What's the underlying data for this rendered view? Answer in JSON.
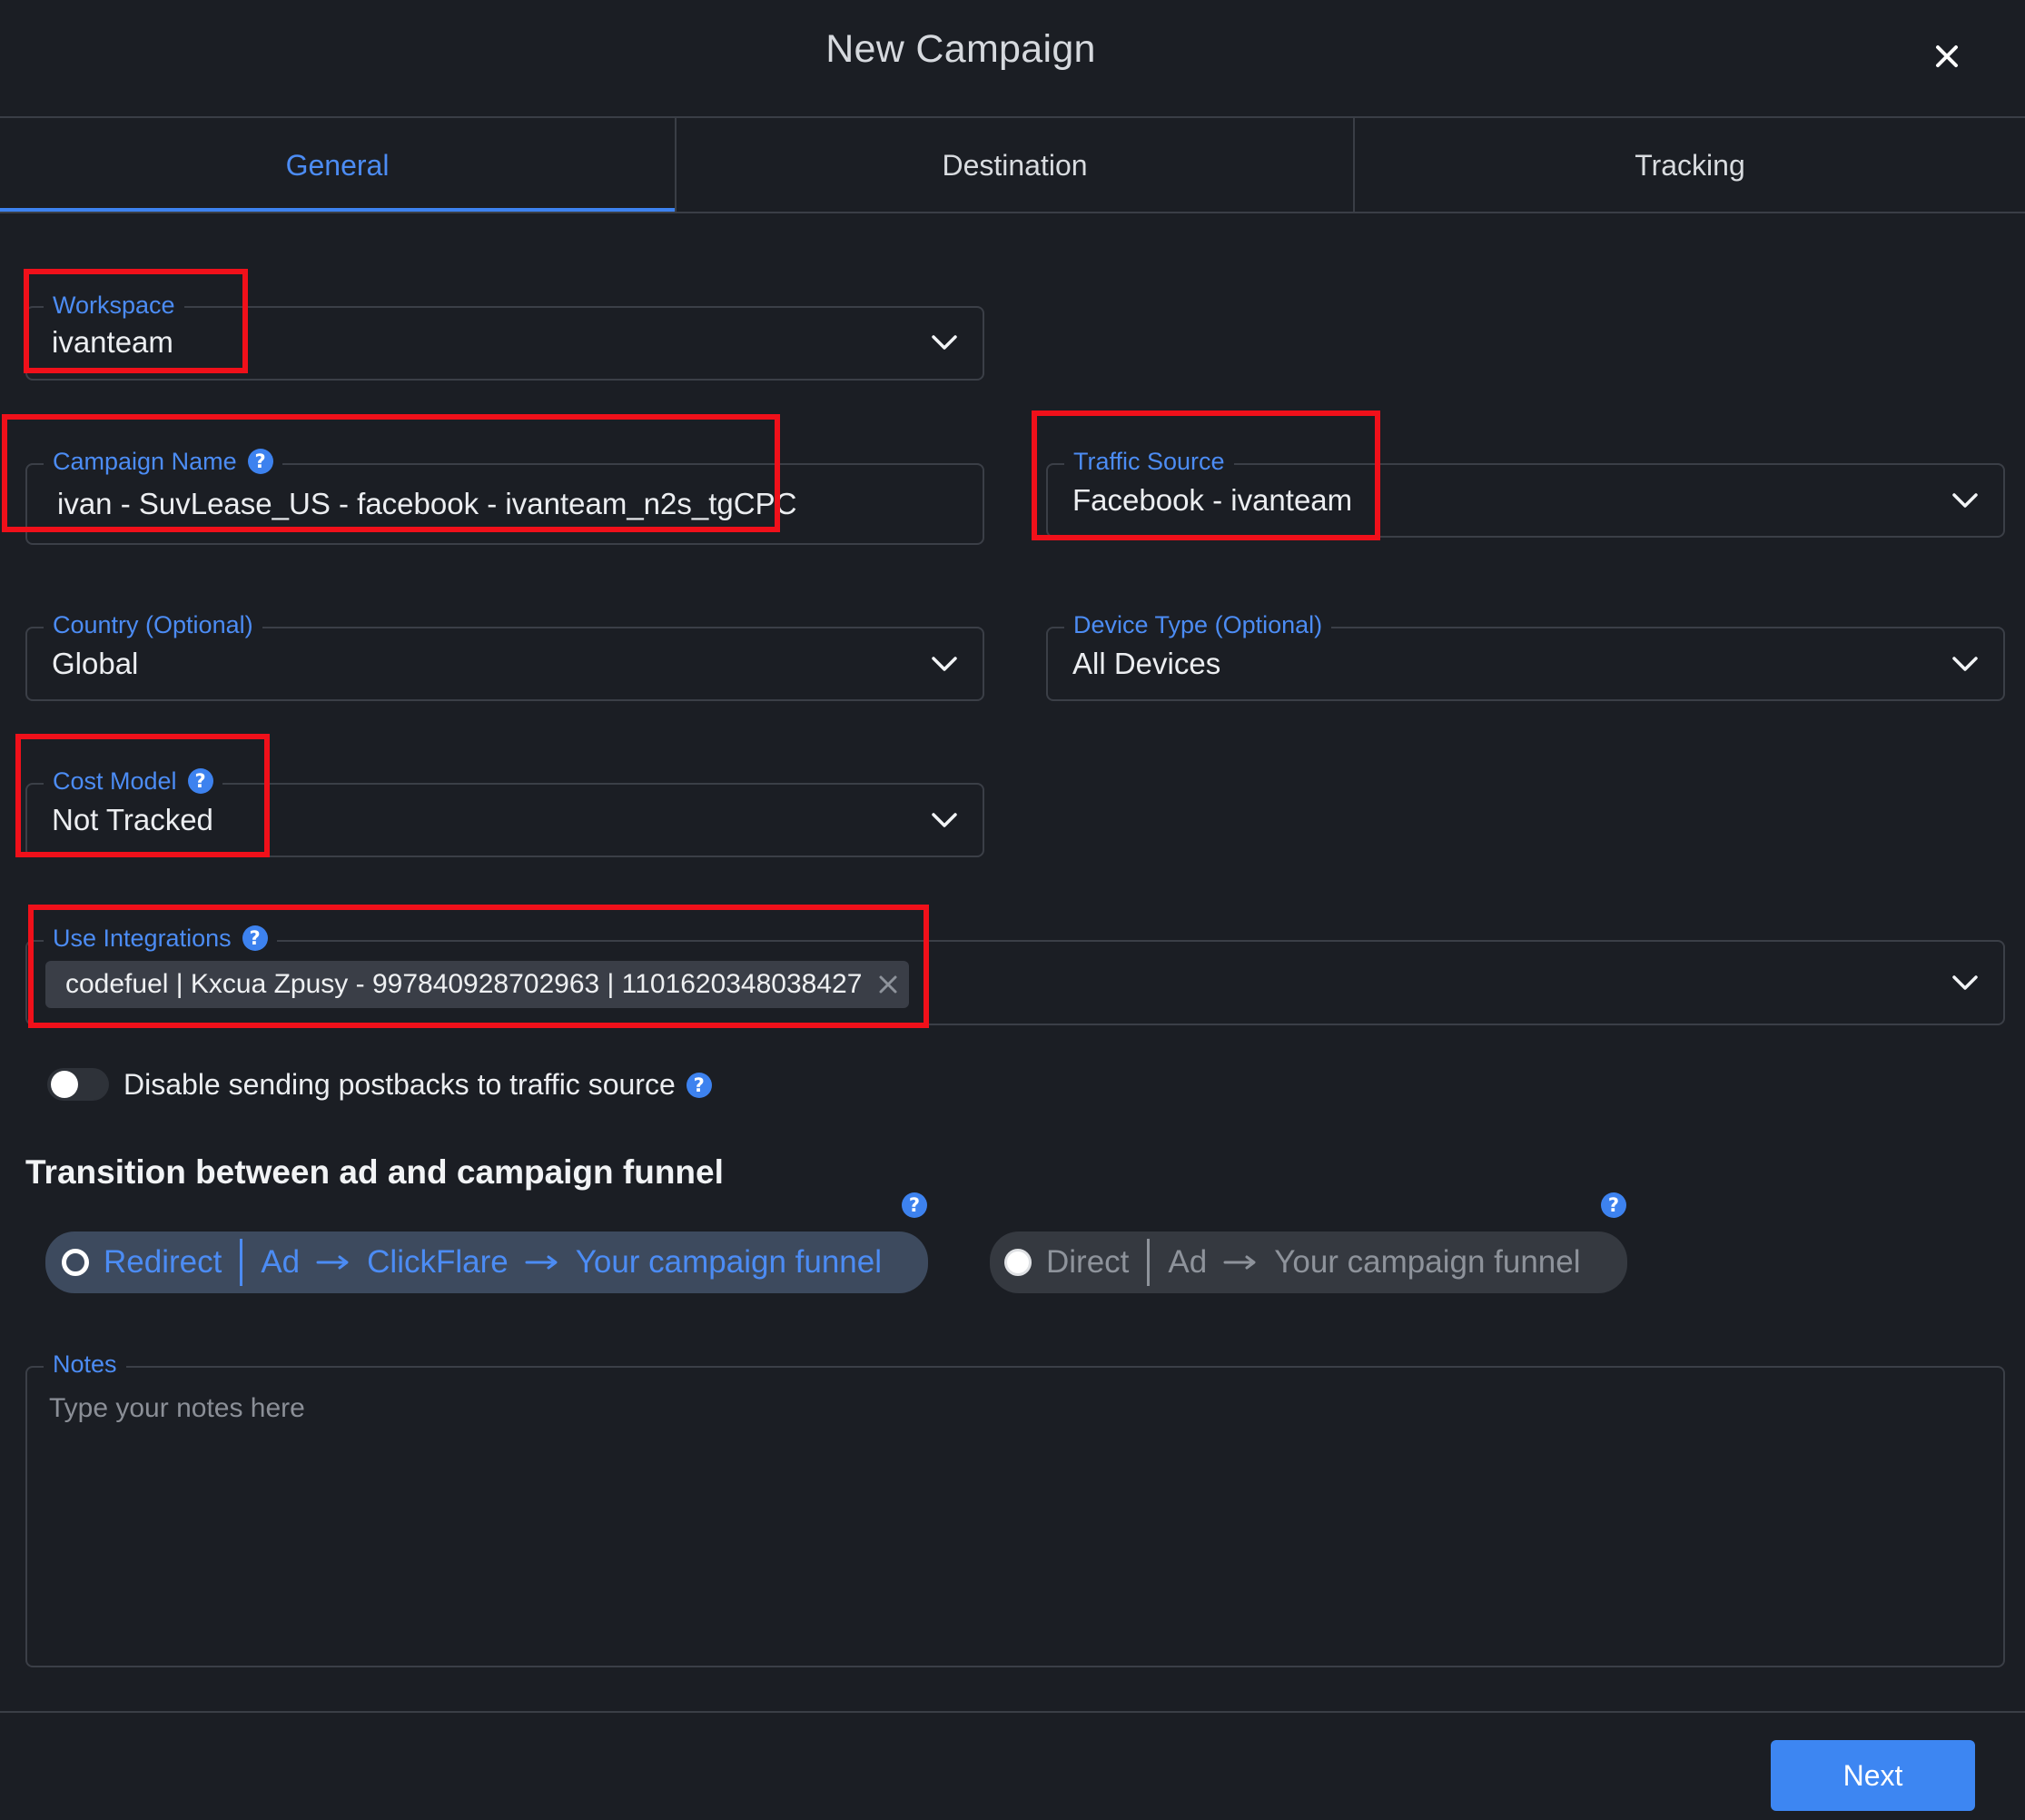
{
  "dialog": {
    "title": "New Campaign"
  },
  "tabs": [
    {
      "label": "General",
      "active": true
    },
    {
      "label": "Destination",
      "active": false
    },
    {
      "label": "Tracking",
      "active": false
    }
  ],
  "fields": {
    "workspace": {
      "label": "Workspace",
      "value": "ivanteam"
    },
    "campaign_name": {
      "label": "Campaign Name",
      "value": "ivan - SuvLease_US - facebook - ivanteam_n2s_tgCPC"
    },
    "traffic_source": {
      "label": "Traffic Source",
      "value": "Facebook - ivanteam"
    },
    "country": {
      "label": "Country (Optional)",
      "value": "Global"
    },
    "device_type": {
      "label": "Device Type (Optional)",
      "value": "All Devices"
    },
    "cost_model": {
      "label": "Cost Model",
      "value": "Not Tracked"
    },
    "integrations": {
      "label": "Use Integrations",
      "chips": [
        "codefuel | Kxcua Zpusy - 997840928702963 | 1101620348038427"
      ]
    }
  },
  "postback_toggle": {
    "label": "Disable sending postbacks to traffic source",
    "enabled": false
  },
  "transition": {
    "title": "Transition between ad and campaign funnel",
    "redirect": {
      "mode": "Redirect",
      "steps": [
        "Ad",
        "ClickFlare",
        "Your campaign funnel"
      ]
    },
    "direct": {
      "mode": "Direct",
      "steps": [
        "Ad",
        "Your campaign funnel"
      ]
    }
  },
  "notes": {
    "label": "Notes",
    "placeholder": "Type your notes here",
    "value": ""
  },
  "footer": {
    "next_label": "Next"
  },
  "colors": {
    "background": "#1b1e24",
    "accent": "#3d82ef",
    "annotation": "#f0101a"
  }
}
